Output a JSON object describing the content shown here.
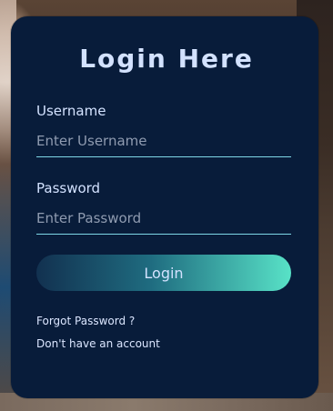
{
  "login_card": {
    "title": "Login Here",
    "username": {
      "label": "Username",
      "placeholder": "Enter Username",
      "value": ""
    },
    "password": {
      "label": "Password",
      "placeholder": "Enter Password",
      "value": ""
    },
    "login_button_label": "Login",
    "forgot_password_label": "Forgot Password ?",
    "no_account_label": "Don't have an account"
  },
  "colors": {
    "card_background": "#081c3a",
    "text": "#d3e2ff",
    "input_underline": "#7ed7e6",
    "button_gradient_start": "#123150",
    "button_gradient_end": "#58e2c7"
  }
}
